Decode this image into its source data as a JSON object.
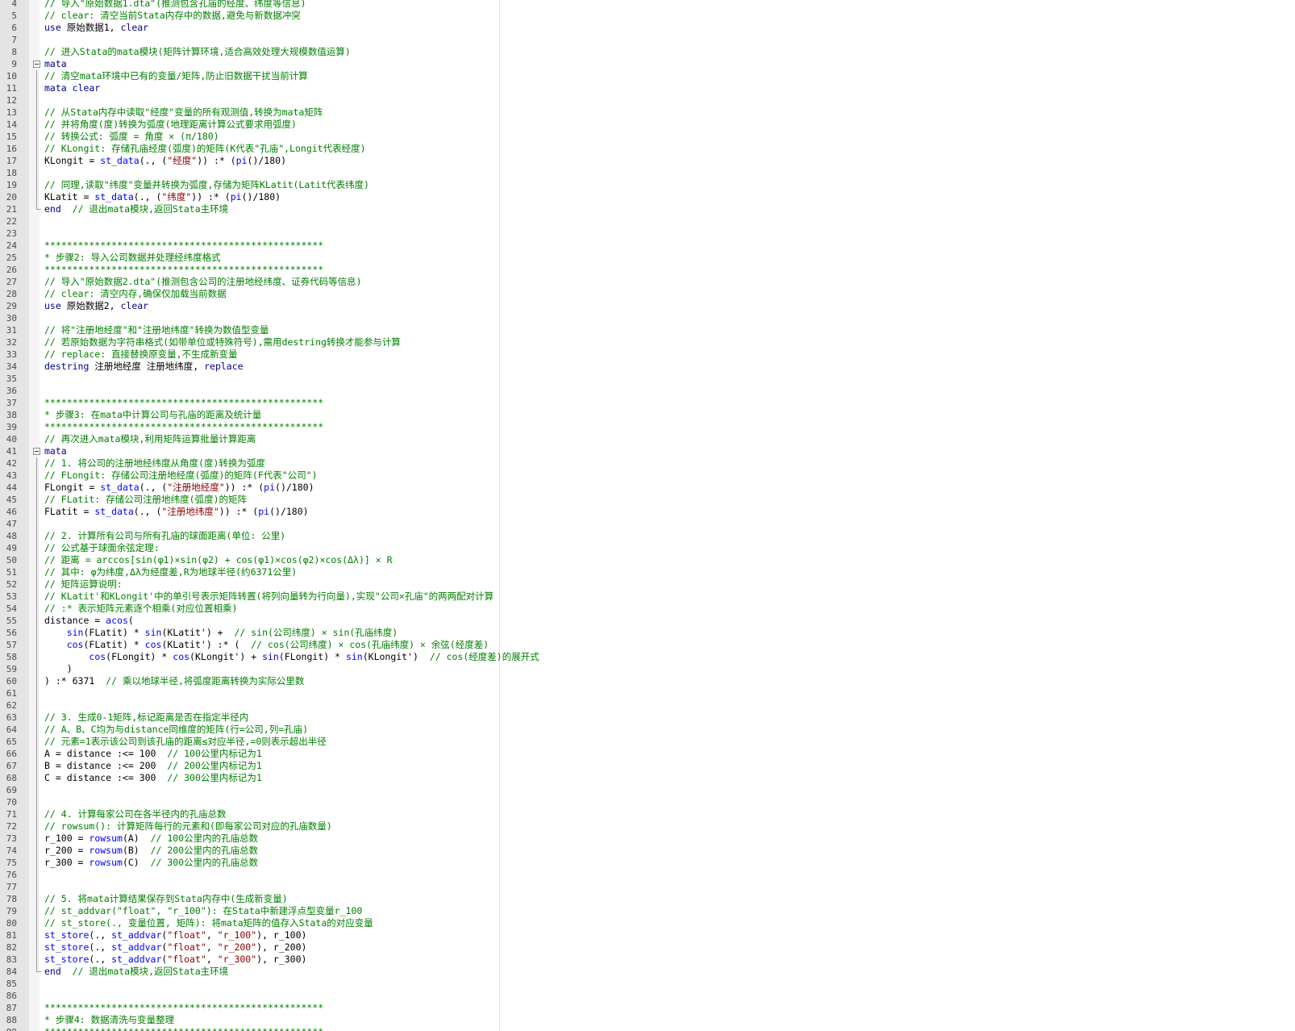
{
  "editor": {
    "colors": {
      "comment": "#008000",
      "keyword": "#00008b",
      "function": "#0000ff",
      "string": "#8b0000",
      "plain": "#000000"
    },
    "lines": [
      {
        "n": "4",
        "t": [
          {
            "c": "// 导入\"原始数据1.dta\"(推测包含孔庙的经度、纬度等信息)",
            "k": "c"
          }
        ]
      },
      {
        "n": "5",
        "t": [
          {
            "c": "// clear: 清空当前Stata内存中的数据,避免与新数据冲突",
            "k": "c"
          }
        ]
      },
      {
        "n": "6",
        "t": [
          {
            "c": "use",
            "k": "k"
          },
          {
            "c": " 原始数据1, ",
            "k": "p"
          },
          {
            "c": "clear",
            "k": "k"
          }
        ]
      },
      {
        "n": "7",
        "t": []
      },
      {
        "n": "8",
        "t": [
          {
            "c": "// 进入Stata的mata模块(矩阵计算环境,适合高效处理大规模数值运算)",
            "k": "c"
          }
        ]
      },
      {
        "n": "9",
        "fold": "start",
        "t": [
          {
            "c": "mata",
            "k": "k"
          }
        ]
      },
      {
        "n": "10",
        "fold": "mid",
        "t": [
          {
            "c": "// 清空mata环境中已有的变量/矩阵,防止旧数据干扰当前计算",
            "k": "c"
          }
        ]
      },
      {
        "n": "11",
        "fold": "mid",
        "t": [
          {
            "c": "mata clear",
            "k": "k"
          }
        ]
      },
      {
        "n": "12",
        "fold": "mid",
        "t": []
      },
      {
        "n": "13",
        "fold": "mid",
        "t": [
          {
            "c": "// 从Stata内存中读取\"经度\"变量的所有观测值,转换为mata矩阵",
            "k": "c"
          }
        ]
      },
      {
        "n": "14",
        "fold": "mid",
        "t": [
          {
            "c": "// 并将角度(度)转换为弧度(地理距离计算公式要求用弧度)",
            "k": "c"
          }
        ]
      },
      {
        "n": "15",
        "fold": "mid",
        "t": [
          {
            "c": "// 转换公式: 弧度 = 角度 × (π/180)",
            "k": "c"
          }
        ]
      },
      {
        "n": "16",
        "fold": "mid",
        "t": [
          {
            "c": "// KLongit: 存储孔庙经度(弧度)的矩阵(K代表\"孔庙\",Longit代表经度)",
            "k": "c"
          }
        ]
      },
      {
        "n": "17",
        "fold": "mid",
        "t": [
          {
            "c": "KLongit = ",
            "k": "p"
          },
          {
            "c": "st_data",
            "k": "f"
          },
          {
            "c": "(., (",
            "k": "p"
          },
          {
            "c": "\"经度\"",
            "k": "s"
          },
          {
            "c": ")) :* (",
            "k": "p"
          },
          {
            "c": "pi",
            "k": "f"
          },
          {
            "c": "()/180)",
            "k": "p"
          }
        ]
      },
      {
        "n": "18",
        "fold": "mid",
        "t": []
      },
      {
        "n": "19",
        "fold": "mid",
        "t": [
          {
            "c": "// 同理,读取\"纬度\"变量并转换为弧度,存储为矩阵KLatit(Latit代表纬度)",
            "k": "c"
          }
        ]
      },
      {
        "n": "20",
        "fold": "mid",
        "t": [
          {
            "c": "KLatit = ",
            "k": "p"
          },
          {
            "c": "st_data",
            "k": "f"
          },
          {
            "c": "(., (",
            "k": "p"
          },
          {
            "c": "\"纬度\"",
            "k": "s"
          },
          {
            "c": ")) :* (",
            "k": "p"
          },
          {
            "c": "pi",
            "k": "f"
          },
          {
            "c": "()/180)",
            "k": "p"
          }
        ]
      },
      {
        "n": "21",
        "fold": "end",
        "t": [
          {
            "c": "end",
            "k": "k"
          },
          {
            "c": "  ",
            "k": "p"
          },
          {
            "c": "// 退出mata模块,返回Stata主环境",
            "k": "c"
          }
        ]
      },
      {
        "n": "22",
        "t": []
      },
      {
        "n": "23",
        "t": []
      },
      {
        "n": "24",
        "t": [
          {
            "c": "**************************************************",
            "k": "c"
          }
        ]
      },
      {
        "n": "25",
        "t": [
          {
            "c": "* 步骤2: 导入公司数据并处理经纬度格式",
            "k": "c"
          }
        ]
      },
      {
        "n": "26",
        "t": [
          {
            "c": "**************************************************",
            "k": "c"
          }
        ]
      },
      {
        "n": "27",
        "t": [
          {
            "c": "// 导入\"原始数据2.dta\"(推测包含公司的注册地经纬度、证券代码等信息)",
            "k": "c"
          }
        ]
      },
      {
        "n": "28",
        "t": [
          {
            "c": "// clear: 清空内存,确保仅加载当前数据",
            "k": "c"
          }
        ]
      },
      {
        "n": "29",
        "t": [
          {
            "c": "use",
            "k": "k"
          },
          {
            "c": " 原始数据2, ",
            "k": "p"
          },
          {
            "c": "clear",
            "k": "k"
          }
        ]
      },
      {
        "n": "30",
        "t": []
      },
      {
        "n": "31",
        "t": [
          {
            "c": "// 将\"注册地经度\"和\"注册地纬度\"转换为数值型变量",
            "k": "c"
          }
        ]
      },
      {
        "n": "32",
        "t": [
          {
            "c": "// 若原始数据为字符串格式(如带单位或特殊符号),需用destring转换才能参与计算",
            "k": "c"
          }
        ]
      },
      {
        "n": "33",
        "t": [
          {
            "c": "// replace: 直接替换原变量,不生成新变量",
            "k": "c"
          }
        ]
      },
      {
        "n": "34",
        "t": [
          {
            "c": "destring",
            "k": "k"
          },
          {
            "c": " 注册地经度 注册地纬度, ",
            "k": "p"
          },
          {
            "c": "replace",
            "k": "k"
          }
        ]
      },
      {
        "n": "35",
        "t": []
      },
      {
        "n": "36",
        "t": []
      },
      {
        "n": "37",
        "t": [
          {
            "c": "**************************************************",
            "k": "c"
          }
        ]
      },
      {
        "n": "38",
        "t": [
          {
            "c": "* 步骤3: 在mata中计算公司与孔庙的距离及统计量",
            "k": "c"
          }
        ]
      },
      {
        "n": "39",
        "t": [
          {
            "c": "**************************************************",
            "k": "c"
          }
        ]
      },
      {
        "n": "40",
        "t": [
          {
            "c": "// 再次进入mata模块,利用矩阵运算批量计算距离",
            "k": "c"
          }
        ]
      },
      {
        "n": "41",
        "fold": "start",
        "t": [
          {
            "c": "mata",
            "k": "k"
          }
        ]
      },
      {
        "n": "42",
        "fold": "mid",
        "t": [
          {
            "c": "// 1. 将公司的注册地经纬度从角度(度)转换为弧度",
            "k": "c"
          }
        ]
      },
      {
        "n": "43",
        "fold": "mid",
        "t": [
          {
            "c": "// FLongit: 存储公司注册地经度(弧度)的矩阵(F代表\"公司\")",
            "k": "c"
          }
        ]
      },
      {
        "n": "44",
        "fold": "mid",
        "t": [
          {
            "c": "FLongit = ",
            "k": "p"
          },
          {
            "c": "st_data",
            "k": "f"
          },
          {
            "c": "(., (",
            "k": "p"
          },
          {
            "c": "\"注册地经度\"",
            "k": "s"
          },
          {
            "c": ")) :* (",
            "k": "p"
          },
          {
            "c": "pi",
            "k": "f"
          },
          {
            "c": "()/180)",
            "k": "p"
          }
        ]
      },
      {
        "n": "45",
        "fold": "mid",
        "t": [
          {
            "c": "// FLatit: 存储公司注册地纬度(弧度)的矩阵",
            "k": "c"
          }
        ]
      },
      {
        "n": "46",
        "fold": "mid",
        "t": [
          {
            "c": "FLatit = ",
            "k": "p"
          },
          {
            "c": "st_data",
            "k": "f"
          },
          {
            "c": "(., (",
            "k": "p"
          },
          {
            "c": "\"注册地纬度\"",
            "k": "s"
          },
          {
            "c": ")) :* (",
            "k": "p"
          },
          {
            "c": "pi",
            "k": "f"
          },
          {
            "c": "()/180)",
            "k": "p"
          }
        ]
      },
      {
        "n": "47",
        "fold": "mid",
        "t": []
      },
      {
        "n": "48",
        "fold": "mid",
        "t": [
          {
            "c": "// 2. 计算所有公司与所有孔庙的球面距离(单位: 公里)",
            "k": "c"
          }
        ]
      },
      {
        "n": "49",
        "fold": "mid",
        "t": [
          {
            "c": "// 公式基于球面余弦定理:",
            "k": "c"
          }
        ]
      },
      {
        "n": "50",
        "fold": "mid",
        "t": [
          {
            "c": "// 距离 = arccos[sin(φ1)×sin(φ2) + cos(φ1)×cos(φ2)×cos(Δλ)] × R",
            "k": "c"
          }
        ]
      },
      {
        "n": "51",
        "fold": "mid",
        "t": [
          {
            "c": "// 其中: φ为纬度,Δλ为经度差,R为地球半径(约6371公里)",
            "k": "c"
          }
        ]
      },
      {
        "n": "52",
        "fold": "mid",
        "t": [
          {
            "c": "// 矩阵运算说明:",
            "k": "c"
          }
        ]
      },
      {
        "n": "53",
        "fold": "mid",
        "t": [
          {
            "c": "// KLatit'和KLongit'中的单引号表示矩阵转置(将列向量转为行向量),实现\"公司×孔庙\"的两两配对计算",
            "k": "c"
          }
        ]
      },
      {
        "n": "54",
        "fold": "mid",
        "t": [
          {
            "c": "// :* 表示矩阵元素逐个相乘(对应位置相乘)",
            "k": "c"
          }
        ]
      },
      {
        "n": "55",
        "fold": "mid",
        "t": [
          {
            "c": "distance = ",
            "k": "p"
          },
          {
            "c": "acos",
            "k": "f"
          },
          {
            "c": "(",
            "k": "p"
          }
        ]
      },
      {
        "n": "56",
        "fold": "mid",
        "t": [
          {
            "c": "    ",
            "k": "p"
          },
          {
            "c": "sin",
            "k": "f"
          },
          {
            "c": "(FLatit) * ",
            "k": "p"
          },
          {
            "c": "sin",
            "k": "f"
          },
          {
            "c": "(KLatit') +  ",
            "k": "p"
          },
          {
            "c": "// sin(公司纬度) × sin(孔庙纬度)",
            "k": "c"
          }
        ]
      },
      {
        "n": "57",
        "fold": "mid",
        "t": [
          {
            "c": "    ",
            "k": "p"
          },
          {
            "c": "cos",
            "k": "f"
          },
          {
            "c": "(FLatit) * ",
            "k": "p"
          },
          {
            "c": "cos",
            "k": "f"
          },
          {
            "c": "(KLatit') :* (  ",
            "k": "p"
          },
          {
            "c": "// cos(公司纬度) × cos(孔庙纬度) × 余弦(经度差)",
            "k": "c"
          }
        ]
      },
      {
        "n": "58",
        "fold": "mid",
        "t": [
          {
            "c": "        ",
            "k": "p"
          },
          {
            "c": "cos",
            "k": "f"
          },
          {
            "c": "(FLongit) * ",
            "k": "p"
          },
          {
            "c": "cos",
            "k": "f"
          },
          {
            "c": "(KLongit') + ",
            "k": "p"
          },
          {
            "c": "sin",
            "k": "f"
          },
          {
            "c": "(FLongit) * ",
            "k": "p"
          },
          {
            "c": "sin",
            "k": "f"
          },
          {
            "c": "(KLongit')  ",
            "k": "p"
          },
          {
            "c": "// cos(经度差)的展开式",
            "k": "c"
          }
        ]
      },
      {
        "n": "59",
        "fold": "mid",
        "t": [
          {
            "c": "    )",
            "k": "p"
          }
        ]
      },
      {
        "n": "60",
        "fold": "mid",
        "t": [
          {
            "c": ") :* 6371  ",
            "k": "p"
          },
          {
            "c": "// 乘以地球半径,将弧度距离转换为实际公里数",
            "k": "c"
          }
        ]
      },
      {
        "n": "61",
        "fold": "mid",
        "t": []
      },
      {
        "n": "62",
        "fold": "mid",
        "t": []
      },
      {
        "n": "63",
        "fold": "mid",
        "t": [
          {
            "c": "// 3. 生成0-1矩阵,标记距离是否在指定半径内",
            "k": "c"
          }
        ]
      },
      {
        "n": "64",
        "fold": "mid",
        "t": [
          {
            "c": "// A、B、C均为与distance同维度的矩阵(行=公司,列=孔庙)",
            "k": "c"
          }
        ]
      },
      {
        "n": "65",
        "fold": "mid",
        "t": [
          {
            "c": "// 元素=1表示该公司到该孔庙的距离≤对应半径,=0则表示超出半径",
            "k": "c"
          }
        ]
      },
      {
        "n": "66",
        "fold": "mid",
        "t": [
          {
            "c": "A = distance :<= 100  ",
            "k": "p"
          },
          {
            "c": "// 100公里内标记为1",
            "k": "c"
          }
        ]
      },
      {
        "n": "67",
        "fold": "mid",
        "t": [
          {
            "c": "B = distance :<= 200  ",
            "k": "p"
          },
          {
            "c": "// 200公里内标记为1",
            "k": "c"
          }
        ]
      },
      {
        "n": "68",
        "fold": "mid",
        "t": [
          {
            "c": "C = distance :<= 300  ",
            "k": "p"
          },
          {
            "c": "// 300公里内标记为1",
            "k": "c"
          }
        ]
      },
      {
        "n": "69",
        "fold": "mid",
        "t": []
      },
      {
        "n": "70",
        "fold": "mid",
        "t": []
      },
      {
        "n": "71",
        "fold": "mid",
        "t": [
          {
            "c": "// 4. 计算每家公司在各半径内的孔庙总数",
            "k": "c"
          }
        ]
      },
      {
        "n": "72",
        "fold": "mid",
        "t": [
          {
            "c": "// rowsum(): 计算矩阵每行的元素和(即每家公司对应的孔庙数量)",
            "k": "c"
          }
        ]
      },
      {
        "n": "73",
        "fold": "mid",
        "t": [
          {
            "c": "r_100 = ",
            "k": "p"
          },
          {
            "c": "rowsum",
            "k": "f"
          },
          {
            "c": "(A)  ",
            "k": "p"
          },
          {
            "c": "// 100公里内的孔庙总数",
            "k": "c"
          }
        ]
      },
      {
        "n": "74",
        "fold": "mid",
        "t": [
          {
            "c": "r_200 = ",
            "k": "p"
          },
          {
            "c": "rowsum",
            "k": "f"
          },
          {
            "c": "(B)  ",
            "k": "p"
          },
          {
            "c": "// 200公里内的孔庙总数",
            "k": "c"
          }
        ]
      },
      {
        "n": "75",
        "fold": "mid",
        "t": [
          {
            "c": "r_300 = ",
            "k": "p"
          },
          {
            "c": "rowsum",
            "k": "f"
          },
          {
            "c": "(C)  ",
            "k": "p"
          },
          {
            "c": "// 300公里内的孔庙总数",
            "k": "c"
          }
        ]
      },
      {
        "n": "76",
        "fold": "mid",
        "t": []
      },
      {
        "n": "77",
        "fold": "mid",
        "t": []
      },
      {
        "n": "78",
        "fold": "mid",
        "t": [
          {
            "c": "// 5. 将mata计算结果保存到Stata内存中(生成新变量)",
            "k": "c"
          }
        ]
      },
      {
        "n": "79",
        "fold": "mid",
        "t": [
          {
            "c": "// st_addvar(\"float\", \"r_100\"): 在Stata中新建浮点型变量r_100",
            "k": "c"
          }
        ]
      },
      {
        "n": "80",
        "fold": "mid",
        "t": [
          {
            "c": "// st_store(., 变量位置, 矩阵): 将mata矩阵的值存入Stata的对应变量",
            "k": "c"
          }
        ]
      },
      {
        "n": "81",
        "fold": "mid",
        "t": [
          {
            "c": "st_store",
            "k": "f"
          },
          {
            "c": "(., ",
            "k": "p"
          },
          {
            "c": "st_addvar",
            "k": "f"
          },
          {
            "c": "(",
            "k": "p"
          },
          {
            "c": "\"float\"",
            "k": "s"
          },
          {
            "c": ", ",
            "k": "p"
          },
          {
            "c": "\"r_100\"",
            "k": "s"
          },
          {
            "c": "), r_100)",
            "k": "p"
          }
        ]
      },
      {
        "n": "82",
        "fold": "mid",
        "t": [
          {
            "c": "st_store",
            "k": "f"
          },
          {
            "c": "(., ",
            "k": "p"
          },
          {
            "c": "st_addvar",
            "k": "f"
          },
          {
            "c": "(",
            "k": "p"
          },
          {
            "c": "\"float\"",
            "k": "s"
          },
          {
            "c": ", ",
            "k": "p"
          },
          {
            "c": "\"r_200\"",
            "k": "s"
          },
          {
            "c": "), r_200)",
            "k": "p"
          }
        ]
      },
      {
        "n": "83",
        "fold": "mid",
        "t": [
          {
            "c": "st_store",
            "k": "f"
          },
          {
            "c": "(., ",
            "k": "p"
          },
          {
            "c": "st_addvar",
            "k": "f"
          },
          {
            "c": "(",
            "k": "p"
          },
          {
            "c": "\"float\"",
            "k": "s"
          },
          {
            "c": ", ",
            "k": "p"
          },
          {
            "c": "\"r_300\"",
            "k": "s"
          },
          {
            "c": "), r_300)",
            "k": "p"
          }
        ]
      },
      {
        "n": "84",
        "fold": "end",
        "t": [
          {
            "c": "end",
            "k": "k"
          },
          {
            "c": "  ",
            "k": "p"
          },
          {
            "c": "// 退出mata模块,返回Stata主环境",
            "k": "c"
          }
        ]
      },
      {
        "n": "85",
        "t": []
      },
      {
        "n": "86",
        "t": []
      },
      {
        "n": "87",
        "t": [
          {
            "c": "**************************************************",
            "k": "c"
          }
        ]
      },
      {
        "n": "88",
        "t": [
          {
            "c": "* 步骤4: 数据清洗与变量整理",
            "k": "c"
          }
        ]
      },
      {
        "n": "89",
        "t": [
          {
            "c": "**************************************************",
            "k": "c"
          }
        ]
      }
    ]
  }
}
